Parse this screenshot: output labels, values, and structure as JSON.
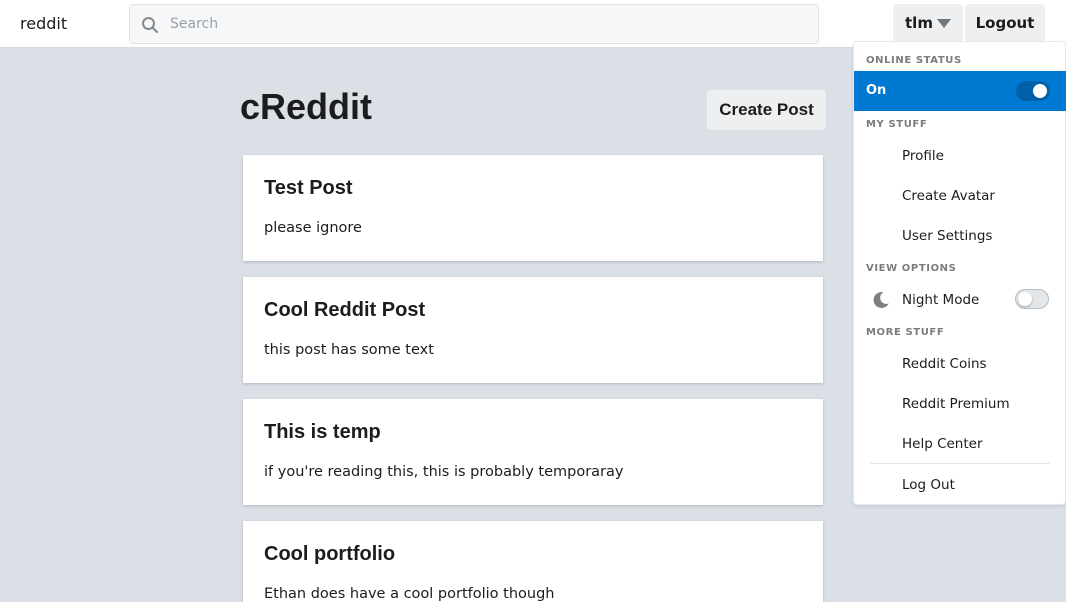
{
  "header": {
    "brand": "reddit",
    "search_placeholder": "Search",
    "username": "tlm",
    "logout_label": "Logout"
  },
  "main": {
    "title": "cReddit",
    "create_post_label": "Create Post",
    "posts": [
      {
        "title": "Test Post",
        "body": "please ignore"
      },
      {
        "title": "Cool Reddit Post",
        "body": "this post has some text"
      },
      {
        "title": "This is temp",
        "body": "if you're reading this, this is probably temporaray"
      },
      {
        "title": "Cool portfolio",
        "body": "Ethan does have a cool portfolio though"
      }
    ]
  },
  "menu": {
    "online_status_label": "ONLINE STATUS",
    "online_status_value": "On",
    "online_status_enabled": true,
    "my_stuff_label": "MY STUFF",
    "my_stuff_items": [
      "Profile",
      "Create Avatar",
      "User Settings"
    ],
    "view_options_label": "VIEW OPTIONS",
    "night_mode_label": "Night Mode",
    "night_mode_enabled": false,
    "more_stuff_label": "MORE STUFF",
    "more_stuff_items": [
      "Reddit Coins",
      "Reddit Premium",
      "Help Center"
    ],
    "log_out_label": "Log Out"
  },
  "icons": {
    "search": "search-icon",
    "caret": "caret-down-icon",
    "night_mode": "moon-icon"
  },
  "colors": {
    "accent": "#0079d3",
    "background": "#dae0e6"
  }
}
